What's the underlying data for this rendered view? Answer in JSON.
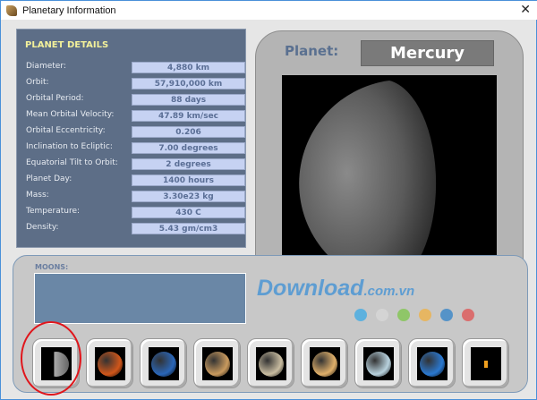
{
  "window": {
    "title": "Planetary Information",
    "close_icon": "close-icon"
  },
  "details": {
    "heading": "PLANET DETAILS",
    "rows": [
      {
        "label": "Diameter:",
        "value": "4,880 km"
      },
      {
        "label": "Orbit:",
        "value": "57,910,000 km"
      },
      {
        "label": "Orbital Period:",
        "value": "88 days"
      },
      {
        "label": "Mean Orbital Velocity:",
        "value": "47.89 km/sec"
      },
      {
        "label": "Orbital  Eccentricity:",
        "value": "0.206"
      },
      {
        "label": "Inclination to Ecliptic:",
        "value": "7.00 degrees"
      },
      {
        "label": "Equatorial Tilt to Orbit:",
        "value": "2 degrees"
      },
      {
        "label": "Planet Day:",
        "value": "1400 hours"
      },
      {
        "label": "Mass:",
        "value": "3.30e23 kg"
      },
      {
        "label": "Temperature:",
        "value": "430 C"
      },
      {
        "label": "Density:",
        "value": "5.43 gm/cm3"
      }
    ]
  },
  "viewer": {
    "label": "Planet:",
    "name": "Mercury"
  },
  "moons": {
    "label": "MOONS:",
    "value": ""
  },
  "planets": [
    {
      "name": "mercury",
      "color": "#9a9a9a",
      "selected": true
    },
    {
      "name": "venus",
      "color": "#d0561a"
    },
    {
      "name": "earth",
      "color": "#2a66b8"
    },
    {
      "name": "mars",
      "color": "#c99a5e"
    },
    {
      "name": "jupiter",
      "color": "#c8bca0"
    },
    {
      "name": "saturn",
      "color": "#e0b06a"
    },
    {
      "name": "uranus",
      "color": "#b8d2de"
    },
    {
      "name": "neptune",
      "color": "#2a78d0"
    },
    {
      "name": "pluto",
      "color": "#000000"
    }
  ],
  "watermark": {
    "text": "Download",
    "suffix": ".com.vn",
    "dots": [
      "#3aa9e6",
      "#d8d8d8",
      "#7cc548",
      "#f0b040",
      "#2f82c8",
      "#e05050"
    ]
  }
}
